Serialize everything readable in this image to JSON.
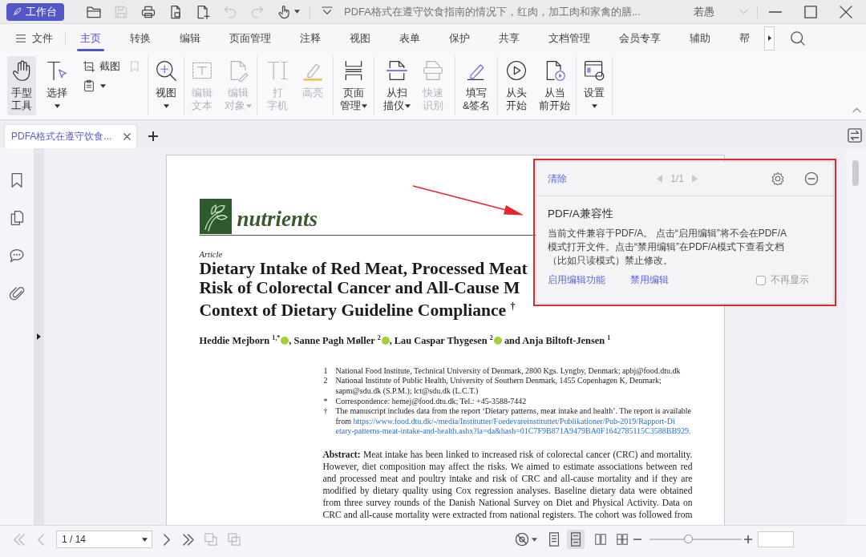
{
  "title_bar": {
    "workspace_button": "工作台",
    "quick_tools": [
      {
        "kind": "open",
        "disabled": false,
        "dropdown": false
      },
      {
        "kind": "save",
        "disabled": true,
        "dropdown": false
      },
      {
        "kind": "print",
        "disabled": false,
        "dropdown": false
      },
      {
        "kind": "export",
        "disabled": false,
        "dropdown": false
      },
      {
        "kind": "new",
        "disabled": false,
        "dropdown": false
      },
      {
        "kind": "undo",
        "disabled": true,
        "dropdown": false
      },
      {
        "kind": "redo",
        "disabled": true,
        "dropdown": false
      },
      {
        "kind": "touch",
        "disabled": false,
        "dropdown": true
      }
    ],
    "document_title": "PDFA格式在遵守饮食指南的情况下，红肉，加工肉和家禽的膳...",
    "user": "若愚"
  },
  "menu": {
    "file": "文件",
    "tabs": [
      {
        "label": "主页",
        "selected": true
      },
      {
        "label": "转换",
        "selected": false
      },
      {
        "label": "编辑",
        "selected": false
      },
      {
        "label": "页面管理",
        "selected": false
      },
      {
        "label": "注释",
        "selected": false
      },
      {
        "label": "视图",
        "selected": false
      },
      {
        "label": "表单",
        "selected": false
      },
      {
        "label": "保护",
        "selected": false
      },
      {
        "label": "共享",
        "selected": false
      },
      {
        "label": "文档管理",
        "selected": false
      },
      {
        "label": "会员专享",
        "selected": false
      },
      {
        "label": "辅助",
        "selected": false
      },
      {
        "label": "帮",
        "selected": false
      }
    ]
  },
  "ribbon": {
    "groups": [
      {
        "items": [
          {
            "kind": "hand",
            "lines": [
              "手型",
              "工具"
            ],
            "selected": true,
            "disabled": false,
            "dropdown": false
          },
          {
            "kind": "select",
            "lines": [
              "选择"
            ],
            "selected": false,
            "disabled": false,
            "dropdown": true
          }
        ],
        "small_items": [
          {
            "kind": "snapshot",
            "label": "截图",
            "disabled": false,
            "dropdown": false
          },
          {
            "kind": "clipboard",
            "disabled": false,
            "dropdown": true
          },
          {
            "kind": "bookmark",
            "disabled": true,
            "dropdown": false
          }
        ]
      },
      {
        "items": [
          {
            "kind": "view",
            "lines": [
              "视图"
            ],
            "selected": false,
            "disabled": false,
            "dropdown": true
          }
        ]
      },
      {
        "items": [
          {
            "kind": "edittext",
            "lines": [
              "编辑",
              "文本"
            ],
            "selected": false,
            "disabled": true,
            "dropdown": false
          },
          {
            "kind": "editobject",
            "lines": [
              "编辑",
              "对象"
            ],
            "selected": false,
            "disabled": true,
            "dropdown": true
          }
        ]
      },
      {
        "items": [
          {
            "kind": "typewriter",
            "lines": [
              "打",
              "字机"
            ],
            "selected": false,
            "disabled": true,
            "dropdown": false
          },
          {
            "kind": "highlight",
            "lines": [
              "高亮"
            ],
            "selected": false,
            "disabled": true,
            "dropdown": false
          }
        ]
      },
      {
        "items": [
          {
            "kind": "pagemanage",
            "lines": [
              "页面",
              "管理"
            ],
            "selected": false,
            "disabled": false,
            "dropdown": true
          }
        ]
      },
      {
        "items": [
          {
            "kind": "scan",
            "lines": [
              "从扫",
              "描仪"
            ],
            "selected": false,
            "disabled": false,
            "dropdown": true
          },
          {
            "kind": "ocr",
            "lines": [
              "快速",
              "识别"
            ],
            "selected": false,
            "disabled": true,
            "dropdown": false
          }
        ]
      },
      {
        "items": [
          {
            "kind": "fillsign",
            "lines": [
              "填写",
              "&签名"
            ],
            "selected": false,
            "disabled": false,
            "dropdown": false
          }
        ]
      },
      {
        "items": [
          {
            "kind": "playstart",
            "lines": [
              "从头",
              "开始"
            ],
            "selected": false,
            "disabled": false,
            "dropdown": false
          },
          {
            "kind": "playcurrent",
            "lines": [
              "从当",
              "前开始"
            ],
            "selected": false,
            "disabled": false,
            "dropdown": false
          }
        ]
      },
      {
        "items": [
          {
            "kind": "settings",
            "lines": [
              "设置"
            ],
            "selected": false,
            "disabled": false,
            "dropdown": true
          }
        ]
      }
    ]
  },
  "document_tabs": [
    {
      "label": "PDFA格式在遵守饮食...",
      "selected": true
    }
  ],
  "document": {
    "journal": "nutrients",
    "article_type": "Article",
    "title_lines": [
      "Dietary Intake of Red Meat, Processed Meat",
      "Risk of Colorectal Cancer and All-Cause M",
      "Context of Dietary Guideline Compliance $^{†}$"
    ],
    "authors": [
      {
        "text": "Heddie Mejborn $^{1,*}$",
        "orcid": true
      },
      {
        "text": ", Sanne Pagh Møller $^{2}$",
        "orcid": true
      },
      {
        "text": ", Lau Caspar Thygesen $^{2}$",
        "orcid": true
      },
      {
        "text": " and Anja Biltoft-Jensen $^{1}$",
        "orcid": false
      }
    ],
    "footnotes": [
      {
        "mark": "1",
        "text": "National Food Institute, Technical University of Denmark, 2800 Kgs. Lyngby, Denmark; apbj@food.dtu.dk"
      },
      {
        "mark": "2",
        "text": "National Institute of Public Health, University of Southern Denmark, 1455 Copenhagen K, Denmark; sapm@sdu.dk (S.P.M.); lct@sdu.dk (L.C.T.)"
      },
      {
        "mark": "*",
        "text": "Correspondence: hemej@food.dtu.dk; Tel.: +45-3588-7442"
      },
      {
        "mark": "†",
        "text": "The manuscript includes data from the report ‘Dietary patterns, meat intake and health’. The report is available from",
        "link_lines": [
          "https://www.food.dtu.dk/-/media/Institutter/Foedevareinstituttet/Publikationer/Pub-2019/Rapport-Di",
          "etary-patterns-meat-intake-and-health.ashx?la=da&hash=01C7F9B871A9479BA0F1642785115C3588BB929."
        ]
      }
    ],
    "abstract": "**Abstract:** Meat intake has been linked to increased risk of colorectal cancer (CRC) and mortality. However, diet composition may affect the risks. We aimed to estimate associations between red and processed meat and poultry intake and risk of CRC and all-cause mortality and if they are modified by dietary quality using Cox regression analyses. Baseline dietary data were obtained from three survey rounds of the Danish National Survey on Diet and Physical Activity. Data on CRC and all-cause mortality were extracted from national registers. The cohort was followed from"
  },
  "compatibility_panel": {
    "clear": "清除",
    "pager": {
      "label": "1/1",
      "prev": {
        "disabled": true
      },
      "next": {
        "disabled": true
      }
    },
    "heading": "PDF/A兼容性",
    "message": "当前文件兼容于PDF/A。 点击“启用编辑”将不会在PDF/A模式打开文件。点击“禁用编辑”在PDF/A模式下查看文档（比如只读模式）禁止修改。",
    "actions": [
      "启用编辑功能",
      "禁用编辑"
    ],
    "dont_show_again": {
      "label": "不再显示",
      "checked": false
    }
  },
  "status_bar": {
    "nav_back": [
      {
        "kind": "first",
        "disabled": true
      },
      {
        "kind": "previous",
        "disabled": true
      }
    ],
    "page": "1 / 14",
    "nav_forward": [
      {
        "kind": "next",
        "disabled": false
      },
      {
        "kind": "last",
        "disabled": false
      }
    ],
    "page_tools": [
      {
        "kind": "extract",
        "disabled": true
      },
      {
        "kind": "duplicate",
        "disabled": true
      }
    ],
    "view_modes": [
      {
        "kind": "single",
        "selected": false
      },
      {
        "kind": "continuous",
        "selected": true
      },
      {
        "kind": "facing",
        "selected": false
      },
      {
        "kind": "facing_continuous",
        "selected": false
      }
    ],
    "zoom": {
      "level": 0.42
    }
  }
}
